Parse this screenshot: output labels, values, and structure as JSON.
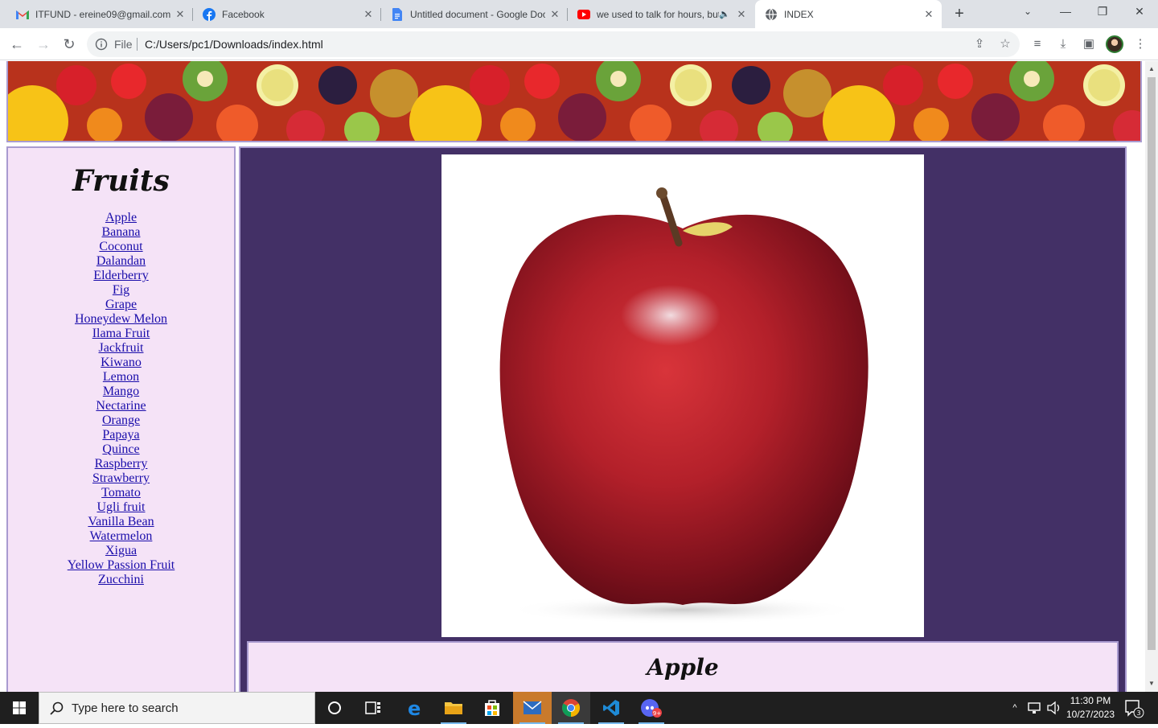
{
  "browser": {
    "tabs": [
      {
        "title": "ITFUND - ereine09@gmail.com",
        "icon": "gmail-icon"
      },
      {
        "title": "Facebook",
        "icon": "facebook-icon"
      },
      {
        "title": "Untitled document - Google Docs",
        "icon": "google-docs-icon"
      },
      {
        "title": "we used to talk for hours, but",
        "icon": "youtube-icon"
      },
      {
        "title": "INDEX",
        "icon": "globe-icon"
      }
    ],
    "address": {
      "scheme_label": "File",
      "url": "C:/Users/pc1/Downloads/index.html"
    }
  },
  "page": {
    "sidebar": {
      "heading": "Fruits",
      "links": [
        "Apple",
        "Banana",
        "Coconut",
        "Dalandan",
        "Elderberry",
        "Fig",
        "Grape",
        "Honeydew Melon",
        "Ilama Fruit",
        "Jackfruit",
        "Kiwano",
        "Lemon",
        "Mango",
        "Nectarine",
        "Orange",
        "Papaya",
        "Quince",
        "Raspberry",
        "Strawberry",
        "Tomato",
        "Ugli fruit",
        "Vanilla Bean",
        "Watermelon",
        "Xigua",
        "Yellow Passion Fruit",
        "Zucchini"
      ]
    },
    "main": {
      "image_subject": "red apple",
      "caption": "Apple"
    },
    "colors": {
      "main_bg": "#433066",
      "panel_bg": "#f5e3f7",
      "border": "#a99bd0",
      "link": "#1a0dab"
    }
  },
  "taskbar": {
    "search_placeholder": "Type here to search",
    "time": "11:30 PM",
    "date": "10/27/2023",
    "notification_count": "3",
    "discord_badge": "9+"
  }
}
